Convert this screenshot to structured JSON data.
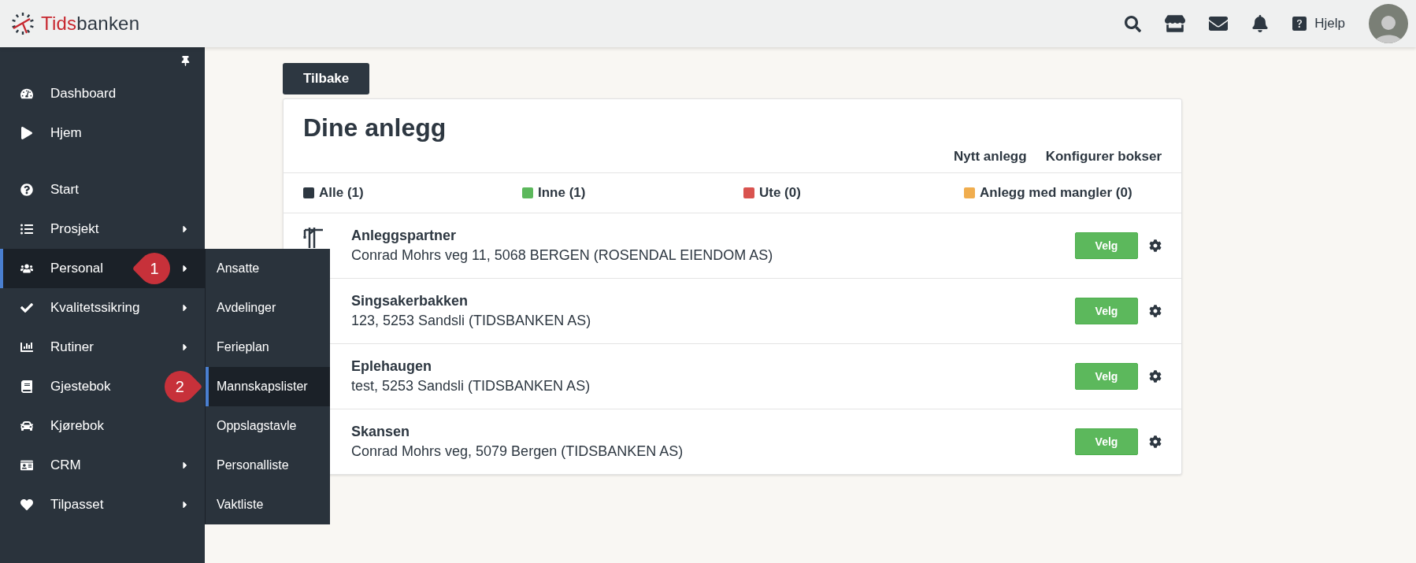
{
  "header": {
    "logo_brand": "Tids",
    "logo_rest": "banken",
    "help_label": "Hjelp"
  },
  "sidebar": {
    "sections": [
      {
        "items": [
          {
            "label": "Dashboard",
            "has_submenu": false,
            "selected": false
          },
          {
            "label": "Hjem",
            "has_submenu": false,
            "selected": false
          }
        ]
      },
      {
        "items": [
          {
            "label": "Start",
            "has_submenu": false,
            "selected": false
          },
          {
            "label": "Prosjekt",
            "has_submenu": true,
            "selected": false
          },
          {
            "label": "Personal",
            "has_submenu": true,
            "selected": true,
            "callout": "1",
            "submenu": [
              {
                "label": "Ansatte",
                "selected": false
              },
              {
                "label": "Avdelinger",
                "selected": false
              },
              {
                "label": "Ferieplan",
                "selected": false
              },
              {
                "label": "Mannskapslister",
                "selected": true,
                "callout": "2"
              },
              {
                "label": "Oppslagstavle",
                "selected": false
              },
              {
                "label": "Personalliste",
                "selected": false
              },
              {
                "label": "Vaktliste",
                "selected": false
              }
            ]
          },
          {
            "label": "Kvalitetssikring",
            "has_submenu": true,
            "selected": false
          },
          {
            "label": "Rutiner",
            "has_submenu": true,
            "selected": false
          },
          {
            "label": "Gjestebok",
            "has_submenu": false,
            "selected": false
          },
          {
            "label": "Kjørebok",
            "has_submenu": false,
            "selected": false
          },
          {
            "label": "CRM",
            "has_submenu": true,
            "selected": false
          },
          {
            "label": "Tilpasset",
            "has_submenu": true,
            "selected": false
          }
        ]
      }
    ]
  },
  "back_button": "Tilbake",
  "card": {
    "title": "Dine anlegg",
    "actions": [
      "Nytt anlegg",
      "Konfigurer bokser"
    ],
    "filters": [
      {
        "label": "Alle (1)",
        "color": "#2d3741"
      },
      {
        "label": "Inne (1)",
        "color": "#5cb85c"
      },
      {
        "label": "Ute (0)",
        "color": "#d9534f"
      },
      {
        "label": "Anlegg med mangler (0)",
        "color": "#f0ad4e"
      }
    ],
    "rows": [
      {
        "name": "Anleggspartner",
        "address": "Conrad Mohrs veg 11, 5068 BERGEN (ROSENDAL EIENDOM AS)",
        "button": "Velg"
      },
      {
        "name": "Singsakerbakken",
        "address": "123, 5253 Sandsli (TIDSBANKEN AS)",
        "button": "Velg"
      },
      {
        "name": "Eplehaugen",
        "address": "test, 5253 Sandsli (TIDSBANKEN AS)",
        "button": "Velg"
      },
      {
        "name": "Skansen",
        "address": "Conrad Mohrs veg, 5079 Bergen (TIDSBANKEN AS)",
        "button": "Velg"
      }
    ]
  }
}
